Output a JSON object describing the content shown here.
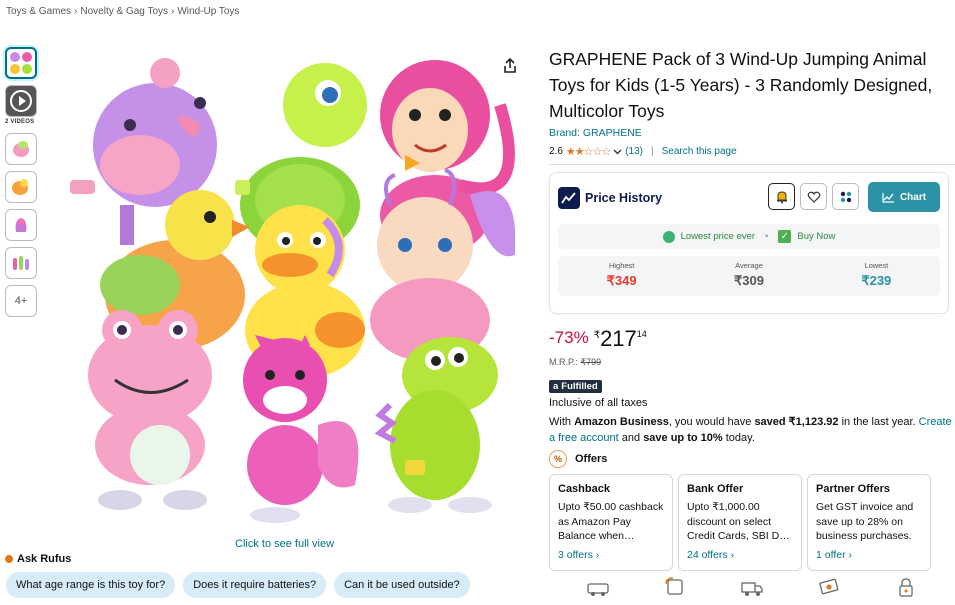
{
  "breadcrumb": [
    "Toys & Games",
    "Novelty & Gag Toys",
    "Wind-Up Toys"
  ],
  "breadcrumb_sep": "›",
  "thumbnails": {
    "videos_label": "2 VIDEOS",
    "more_label": "4+"
  },
  "gallery": {
    "full_view_link": "Click to see full view"
  },
  "rufus": {
    "title": "Ask Rufus",
    "chips": [
      "What age range is this toy for?",
      "Does it require batteries?",
      "Can it be used outside?"
    ]
  },
  "product": {
    "title": "GRAPHENE Pack of 3 Wind-Up Jumping Animal Toys for Kids (1-5 Years) - 3 Randomly Designed, Multicolor Toys",
    "brand": "Brand: GRAPHENE",
    "rating": "2.6",
    "stars": "★★☆☆☆",
    "rating_count": "(13)",
    "search_page": "Search this page"
  },
  "price_history": {
    "title": "Price History",
    "chart_button": "Chart",
    "lowest_ever": "Lowest price ever",
    "buy_now": "Buy Now",
    "stats": [
      {
        "label": "Highest",
        "value": "₹349",
        "color": "#e53935"
      },
      {
        "label": "Average",
        "value": "₹309",
        "color": "#555555"
      },
      {
        "label": "Lowest",
        "value": "₹239",
        "color": "#2b93a5"
      }
    ]
  },
  "price": {
    "discount": "-73%",
    "currency": "₹",
    "whole": "217",
    "fraction": "14",
    "mrp_label": "M.R.P.:",
    "mrp_value": "₹799"
  },
  "fulfilled": {
    "logo": "a",
    "label": "Fulfilled"
  },
  "inclusive": "Inclusive of all taxes",
  "business": {
    "p1": "With ",
    "bold1": "Amazon Business",
    "p2": ", you would have ",
    "bold2": "saved ₹1,123.92",
    "p3": " in the last year. ",
    "link": "Create a free account",
    "p4": " and ",
    "bold3": "save up to 10%",
    "p5": " today."
  },
  "offers": {
    "title": "Offers",
    "cards": [
      {
        "title": "Cashback",
        "body": "Upto ₹50.00 cashback as Amazon Pay Balance when…",
        "link": "3 offers ›"
      },
      {
        "title": "Bank Offer",
        "body": "Upto ₹1,000.00 discount on select Credit Cards, SBI D…",
        "link": "24 offers ›"
      },
      {
        "title": "Partner Offers",
        "body": "Get GST invoice and save up to 28% on business purchases.",
        "link": "1 offer ›"
      }
    ]
  },
  "colors": {
    "link": "#007185",
    "deal": "#cc0c39",
    "teal": "#2b93a5"
  }
}
